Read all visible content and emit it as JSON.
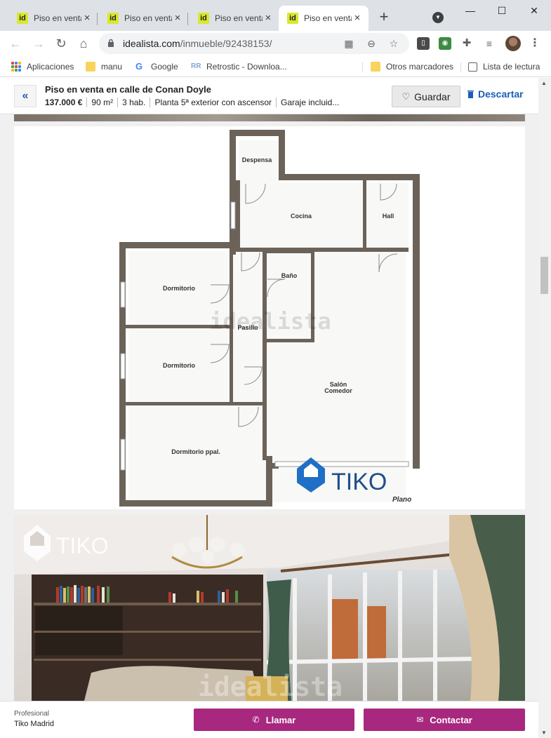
{
  "browser": {
    "tabs": [
      {
        "title": "Piso en venta en",
        "favicon": "id",
        "active": false
      },
      {
        "title": "Piso en venta en",
        "favicon": "id",
        "active": false
      },
      {
        "title": "Piso en venta en",
        "favicon": "id",
        "active": false
      },
      {
        "title": "Piso en venta en",
        "favicon": "id",
        "active": true
      }
    ],
    "url_domain": "idealista.com",
    "url_path": "/inmueble/92438153/",
    "bookmarks": [
      {
        "label": "Aplicaciones",
        "icon": "apps-grid-icon"
      },
      {
        "label": "manu",
        "icon": "folder-icon"
      },
      {
        "label": "Google",
        "icon": "google-icon"
      },
      {
        "label": "Retrostic - Downloa...",
        "icon": "retrostic-icon"
      }
    ],
    "other_bookmarks": "Otros marcadores",
    "reading_list": "Lista de lectura"
  },
  "listing": {
    "title": "Piso en venta en calle de Conan Doyle",
    "price": "137.000 €",
    "area": "90 m²",
    "rooms": "3 hab.",
    "floor": "Planta 5ª exterior con ascensor",
    "garage": "Garaje incluid...",
    "save_label": "Guardar",
    "discard_label": "Descartar",
    "accent_color": "#1a5eb7"
  },
  "floorplan": {
    "rooms": {
      "despensa": "Despensa",
      "cocina": "Cocina",
      "hall": "Hall",
      "bano": "Baño",
      "dormitorio1": "Dormitorio",
      "dormitorio2": "Dormitorio",
      "pasillo": "Pasillo",
      "salon_line1": "Salón",
      "salon_line2": "Comedor",
      "dormitorio_ppal": "Dormitorio ppal."
    },
    "watermark": "idealista",
    "brand_logo": "TIKO",
    "caption": "Plano"
  },
  "photo": {
    "brand_logo": "TIKO",
    "watermark": "idealista"
  },
  "contact": {
    "agent_type": "Profesional",
    "agent_name": "Tiko Madrid",
    "call_label": "Llamar",
    "contact_label": "Contactar",
    "cta_color": "#a8287f"
  }
}
